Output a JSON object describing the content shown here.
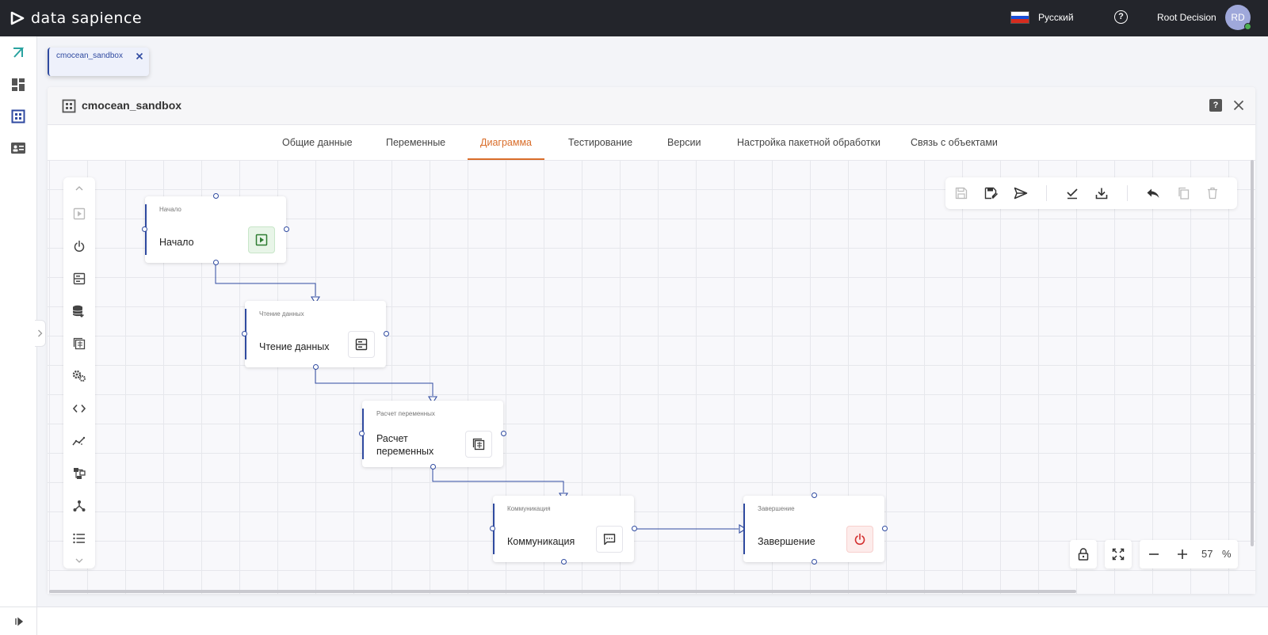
{
  "app": {
    "brand": "data sapience",
    "accent": "#d96d2a",
    "node_accent": "#2f4aa0"
  },
  "topbar": {
    "language": "Русский",
    "user_name": "Root Decision",
    "avatar_initials": "RD"
  },
  "rail": {
    "items": [
      "logo-mark-icon",
      "dashboard-icon",
      "diagram-editor-icon",
      "contact-card-icon"
    ],
    "bottom": "expand-icon"
  },
  "doc_tab": {
    "label": "cmocean_sandbox"
  },
  "panel": {
    "title": "cmocean_sandbox",
    "tabs": [
      {
        "label": "Общие данные",
        "active": false
      },
      {
        "label": "Переменные",
        "active": false
      },
      {
        "label": "Диаграмма",
        "active": true
      },
      {
        "label": "Тестирование",
        "active": false
      },
      {
        "label": "Версии",
        "active": false
      },
      {
        "label": "Настройка пакетной обработки",
        "active": false
      },
      {
        "label": "Связь с объектами",
        "active": false
      }
    ]
  },
  "palette": [
    "chevron-up-icon",
    "start-icon",
    "power-icon",
    "data-read-icon",
    "database-icon",
    "calculation-icon",
    "settings-icon",
    "code-icon",
    "chart-icon",
    "structure-icon",
    "hierarchy-icon",
    "list-icon",
    "chevron-down-icon"
  ],
  "toolbar": [
    "save-icon",
    "save-as-icon",
    "send-icon",
    "validate-icon",
    "download-icon",
    "undo-icon",
    "copy-icon",
    "delete-icon"
  ],
  "zoom": {
    "value": "57",
    "unit": "%"
  },
  "nodes": [
    {
      "type_label": "Начало",
      "label": "Начало",
      "icon": "play-icon",
      "tone": "green"
    },
    {
      "type_label": "Чтение данных",
      "label": "Чтение данных",
      "icon": "data-read-icon",
      "tone": "default"
    },
    {
      "type_label": "Расчет переменных",
      "label": "Расчет переменных",
      "icon": "calculation-icon",
      "tone": "default"
    },
    {
      "type_label": "Коммуникация",
      "label": "Коммуникация",
      "icon": "chat-icon",
      "tone": "default"
    },
    {
      "type_label": "Завершение",
      "label": "Завершение",
      "icon": "power-icon",
      "tone": "red"
    }
  ]
}
